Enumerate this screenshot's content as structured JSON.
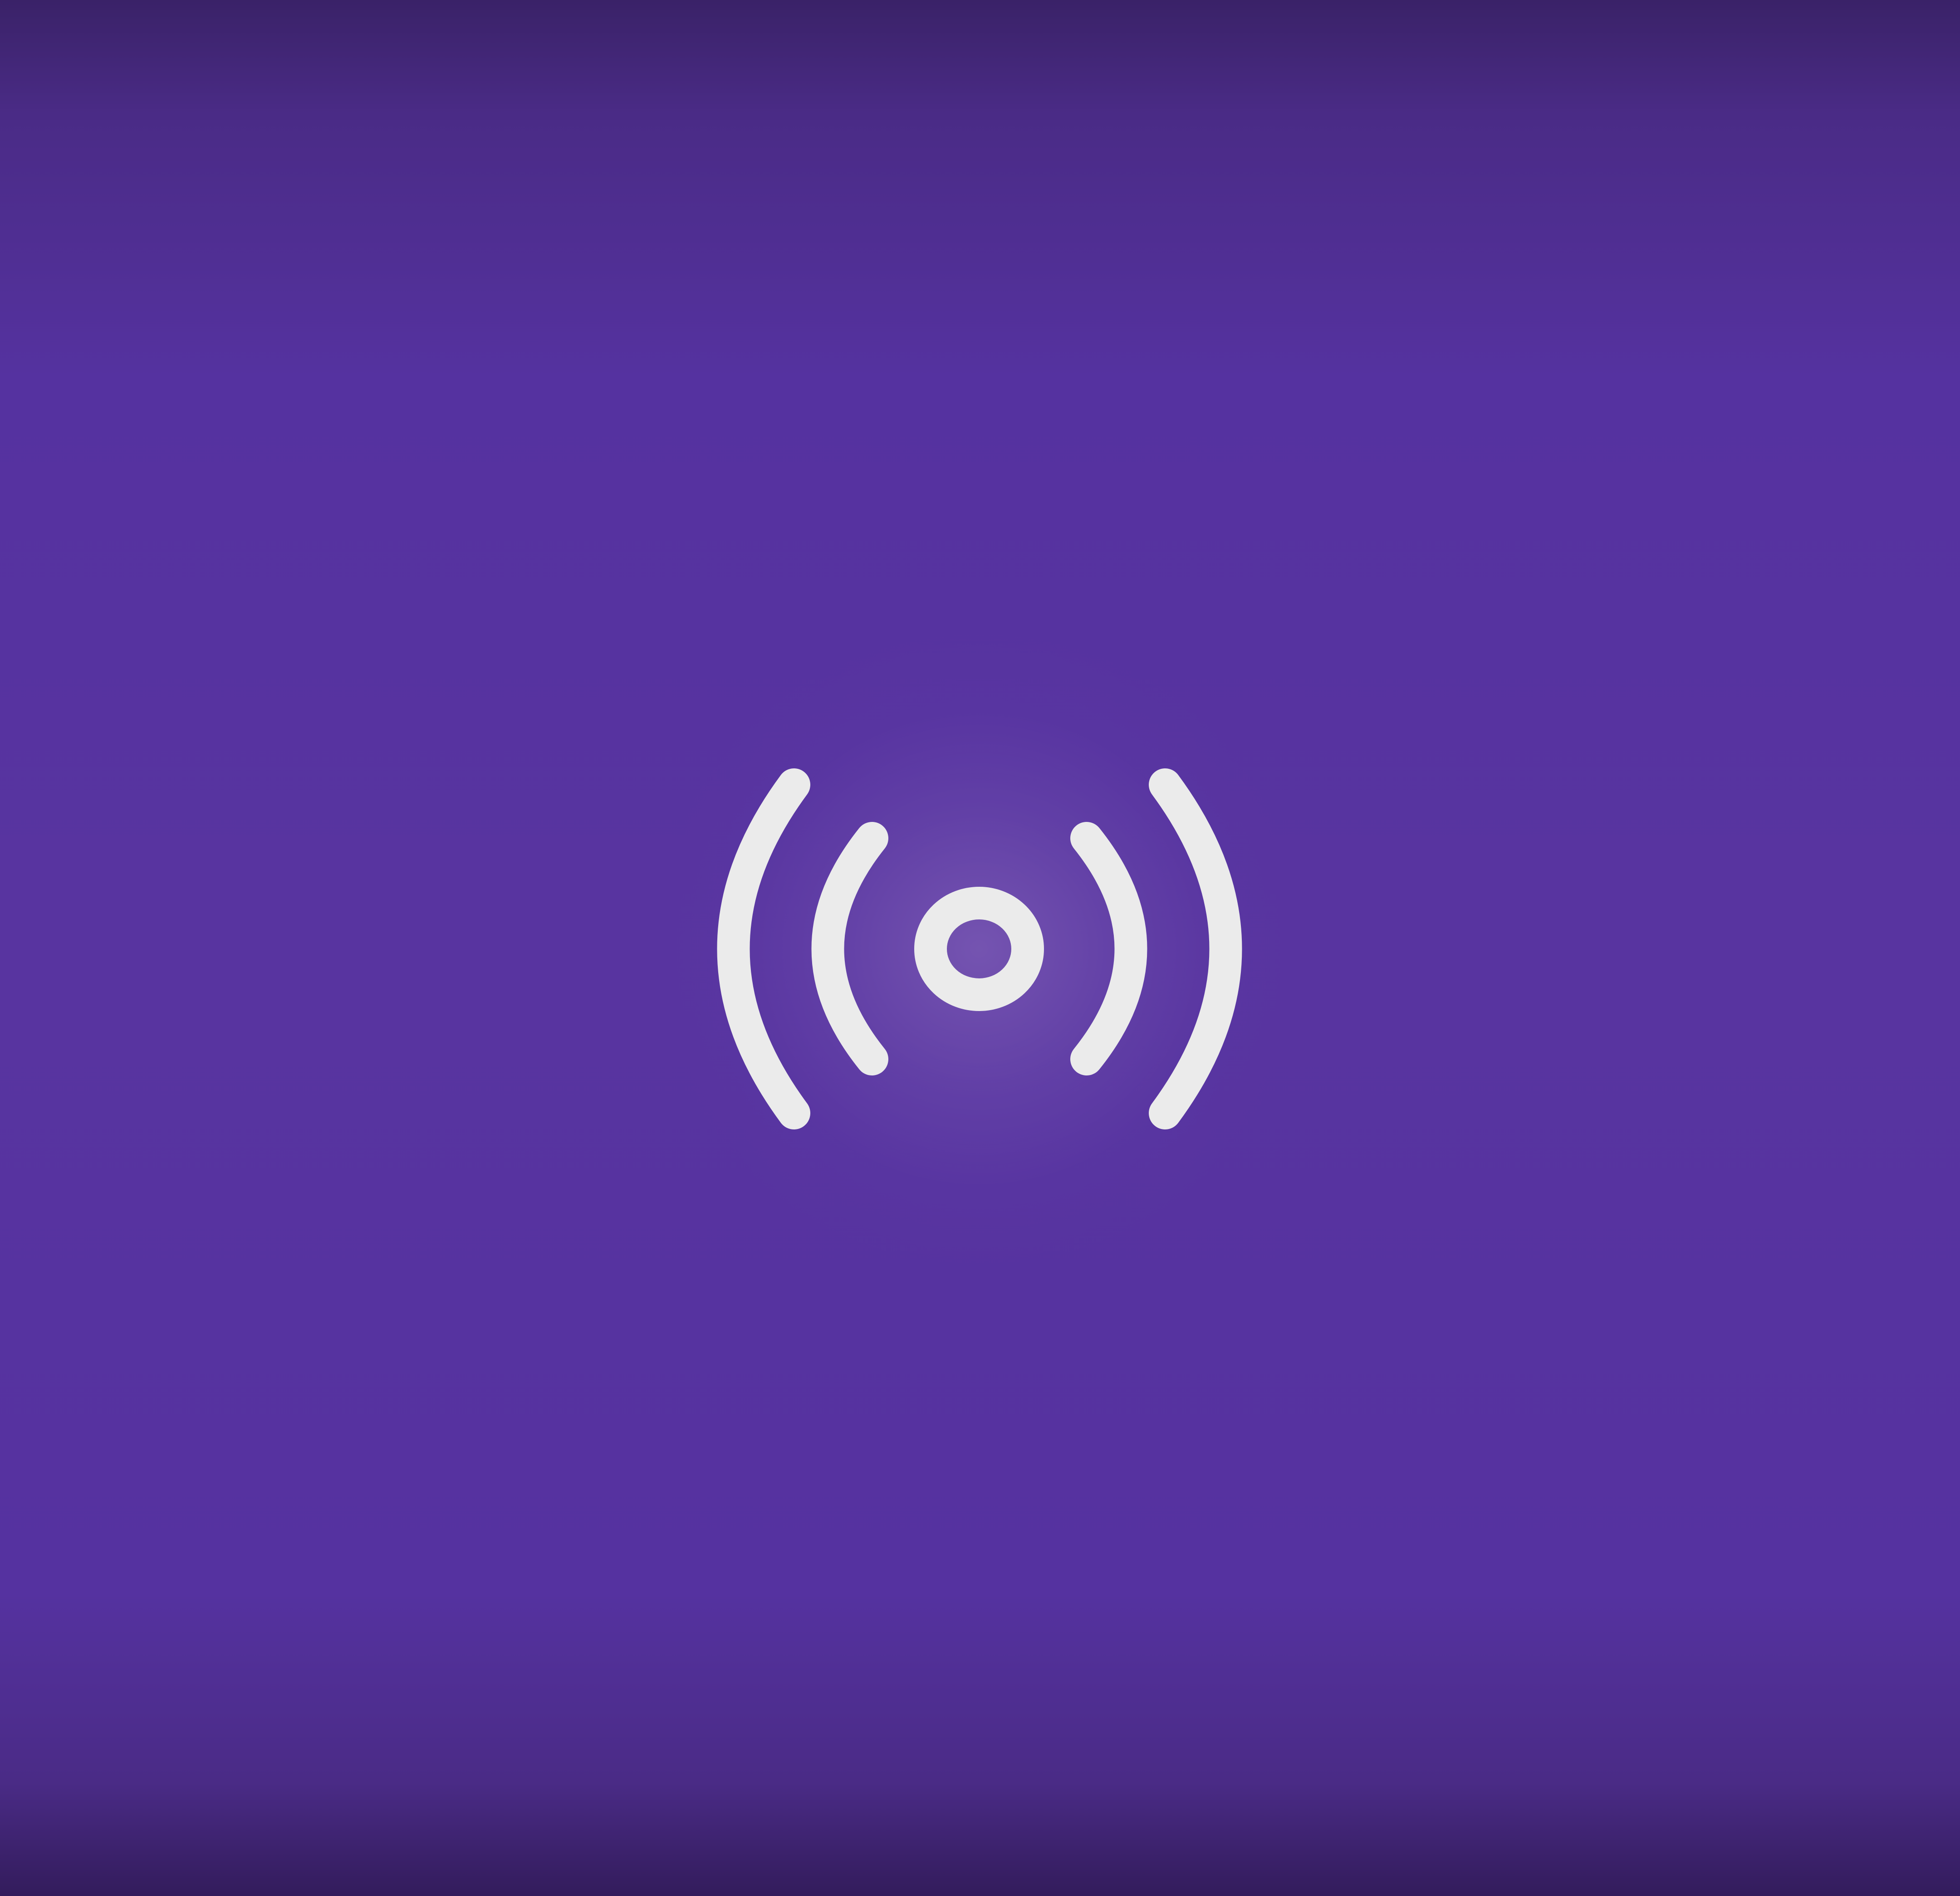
{
  "screen": {
    "icon": "broadcast-icon",
    "background_color": "#5834A0",
    "glow_color": "#8C6EBE",
    "icon_color": "#EBEBEB"
  }
}
